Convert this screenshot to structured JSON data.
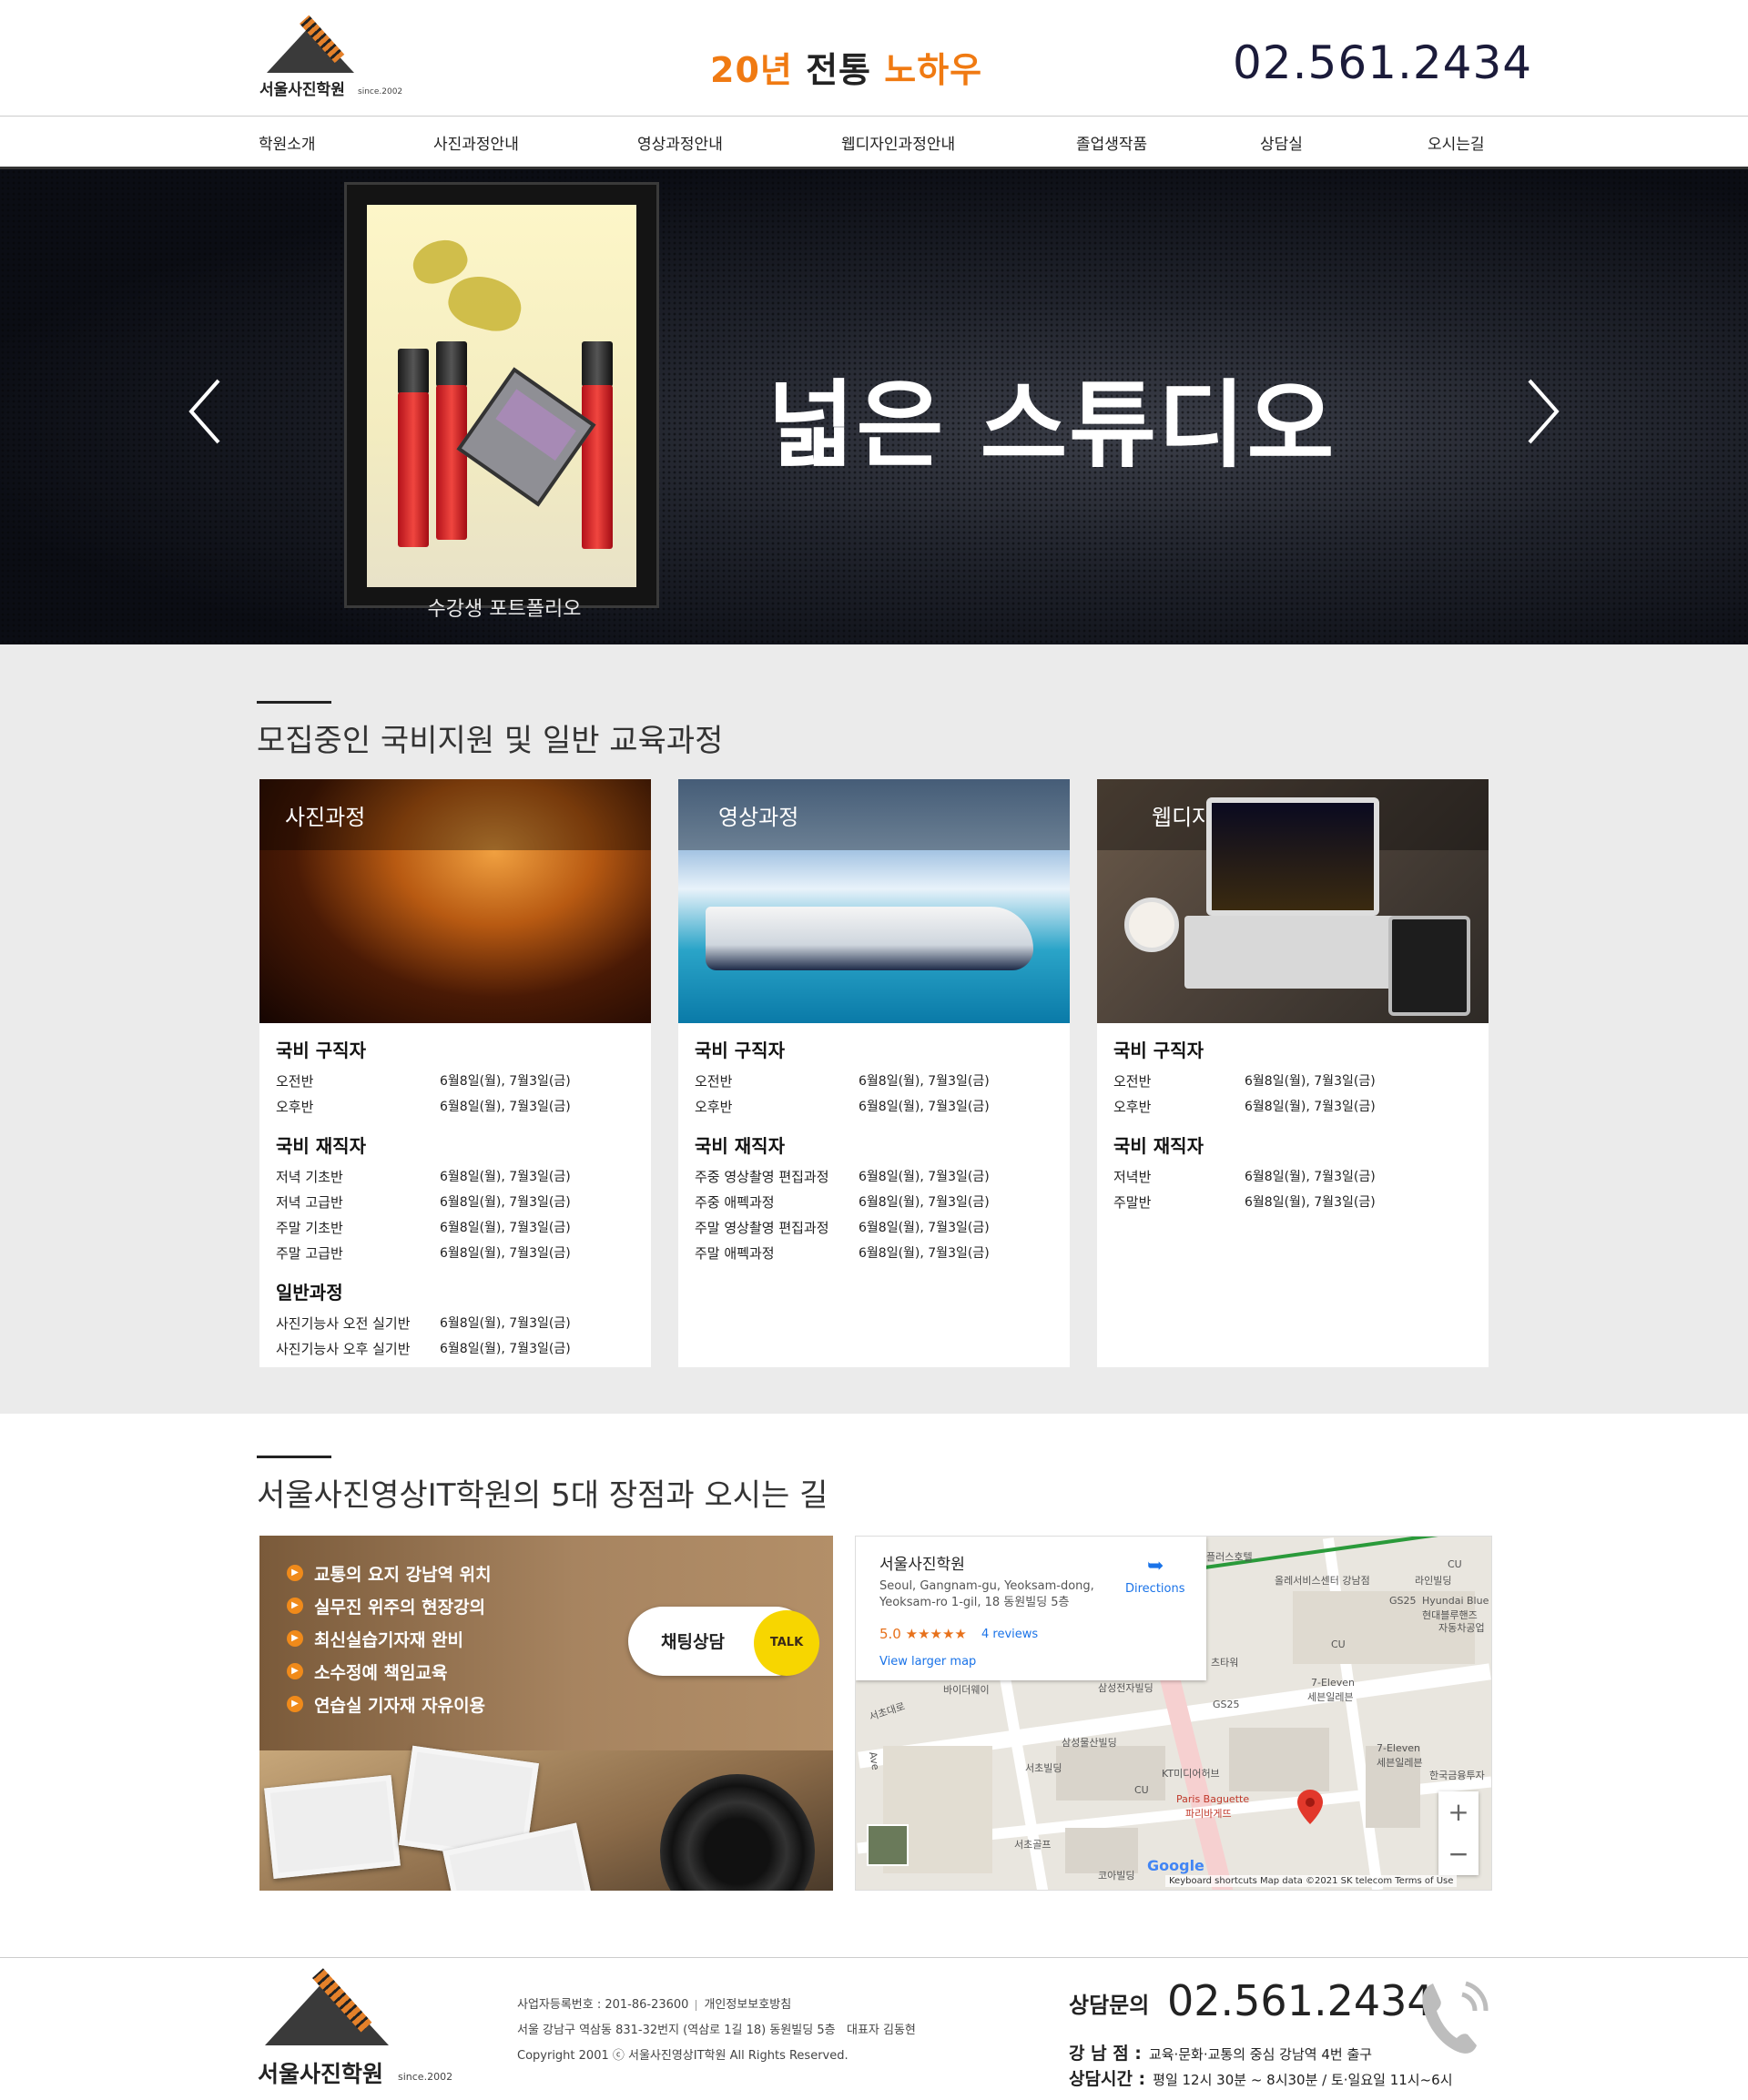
{
  "header": {
    "logo_name": "서울사진학원",
    "logo_since": "since.2002",
    "slogan_a": "20년",
    "slogan_b": "전통",
    "slogan_c": "노하우",
    "phone": "02.561.2434"
  },
  "nav": [
    "학원소개",
    "사진과정안내",
    "영상과정안내",
    "웹디자인과정안내",
    "졸업생작품",
    "상담실",
    "오시는길"
  ],
  "hero": {
    "title": "넓은 스튜디오",
    "caption": "수강생 포트폴리오",
    "prev_icon": "chevron-left-icon",
    "next_icon": "chevron-right-icon"
  },
  "courses": {
    "title": "모집중인 국비지원 및 일반 교육과정",
    "cards": [
      {
        "label": "사진과정",
        "groups": [
          {
            "name": "국비 구직자",
            "rows": [
              [
                "오전반",
                "6월8일(월), 7월3일(금)"
              ],
              [
                "오후반",
                "6월8일(월), 7월3일(금)"
              ]
            ]
          },
          {
            "name": "국비 재직자",
            "rows": [
              [
                "저녁 기초반",
                "6월8일(월), 7월3일(금)"
              ],
              [
                "저녁 고급반",
                "6월8일(월), 7월3일(금)"
              ],
              [
                "주말 기초반",
                "6월8일(월), 7월3일(금)"
              ],
              [
                "주말 고급반",
                "6월8일(월), 7월3일(금)"
              ]
            ]
          },
          {
            "name": "일반과정",
            "rows": [
              [
                "사진기능사 오전 실기반",
                "6월8일(월), 7월3일(금)"
              ],
              [
                "사진기능사 오후 실기반",
                "6월8일(월), 7월3일(금)"
              ]
            ]
          }
        ]
      },
      {
        "label": "영상과정",
        "groups": [
          {
            "name": "국비 구직자",
            "rows": [
              [
                "오전반",
                "6월8일(월), 7월3일(금)"
              ],
              [
                "오후반",
                "6월8일(월), 7월3일(금)"
              ]
            ]
          },
          {
            "name": "국비 재직자",
            "rows": [
              [
                "주중 영상촬영 편집과정",
                "6월8일(월), 7월3일(금)"
              ],
              [
                "주중 애펙과정",
                "6월8일(월), 7월3일(금)"
              ],
              [
                "주말 영상촬영 편집과정",
                "6월8일(월), 7월3일(금)"
              ],
              [
                "주말 애펙과정",
                "6월8일(월), 7월3일(금)"
              ]
            ]
          }
        ]
      },
      {
        "label": "웹디자인과정",
        "groups": [
          {
            "name": "국비 구직자",
            "rows": [
              [
                "오전반",
                "6월8일(월), 7월3일(금)"
              ],
              [
                "오후반",
                "6월8일(월), 7월3일(금)"
              ]
            ]
          },
          {
            "name": "국비 재직자",
            "rows": [
              [
                "저녁반",
                "6월8일(월), 7월3일(금)"
              ],
              [
                "주말반",
                "6월8일(월), 7월3일(금)"
              ]
            ]
          }
        ]
      }
    ]
  },
  "advantages": {
    "title": "서울사진영상IT학원의 5대 장점과 오시는 길",
    "items": [
      "교통의 요지 강남역 위치",
      "실무진 위주의 현장강의",
      "최신실습기자재 완비",
      "소수정예 책임교육",
      "연습실 기자재 자유이용"
    ],
    "chat_label": "채팅상담",
    "talk_label": "TALK"
  },
  "map": {
    "place_name": "서울사진학원",
    "address": "Seoul, Gangnam-gu, Yeoksam-dong, Yeoksam-ro 1-gil, 18 동원빌딩 5층",
    "rating": "5.0 ★★★★★",
    "reviews": "4 reviews",
    "larger_map": "View larger map",
    "directions": "Directions",
    "zoom_in": "+",
    "zoom_out": "−",
    "footer": "Keyboard shortcuts   Map data ©2021 SK telecom   Terms of Use",
    "google": "Google",
    "labels": [
      "플러스호텔",
      "올레서비스센터 강남점",
      "라인빌딩",
      "CU",
      "GS25",
      "Hyundai Blue",
      "현대블루핸즈",
      "자동차공업",
      "CU",
      "츠타워",
      "7-Eleven",
      "세븐일레븐",
      "GS25",
      "삼성전자빌딩",
      "바이더웨이",
      "서초대로",
      "삼성물산빌딩",
      "서초빌딩",
      "KT미디어허브",
      "CU",
      "Paris Baguette",
      "파리바게뜨",
      "7-Eleven",
      "세븐일레븐",
      "서초골프",
      "코아빌딩",
      "한국금융투자",
      "Ave"
    ]
  },
  "footer": {
    "logo_name": "서울사진학원",
    "logo_since": "since.2002",
    "biz_no": "사업자등록번호 : 201-86-23600",
    "privacy": "개인정보보호방침",
    "address": "서울 강남구 역삼동 831-32번지 (역삼로 1길 18) 동원빌딩 5층",
    "ceo": "대표자  김동현",
    "copyright": "Copyright 2001  ⓒ 서울사진영상IT학원   All Rights Reserved.",
    "contact_label": "상담문의",
    "contact_phone": "02.561.2434",
    "branch_label": "강 남 점 :",
    "branch_text": "교육·문화·교통의 중심  강남역 4번 출구",
    "hours_label": "상담시간 :",
    "hours_text": "평일 12시 30분 ~ 8시30분 / 토·일요일  11시~6시"
  }
}
